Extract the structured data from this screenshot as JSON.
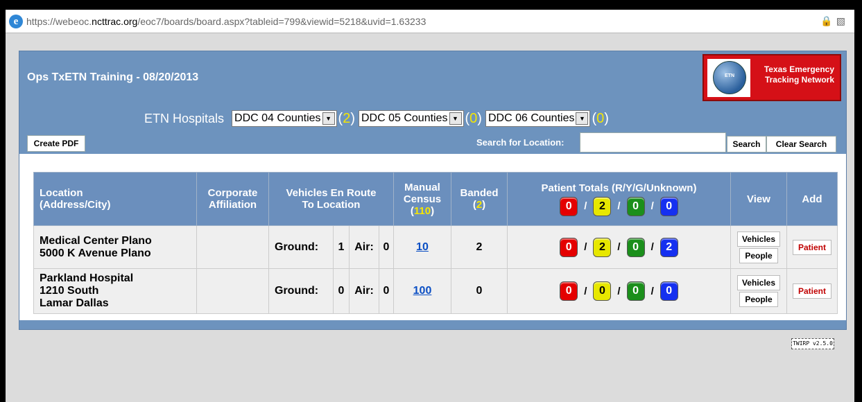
{
  "browser": {
    "url_prefix": "https://webeoc.",
    "url_domain": "ncttrac.org",
    "url_suffix": "/eoc7/boards/board.aspx?tableid=799&viewid=5218&uvid=1.63233"
  },
  "board": {
    "title": "Ops TxETN Training - 08/20/2013",
    "logo_line1": "Texas Emergency",
    "logo_line2": "Tracking Network",
    "logo_badge": "ETN",
    "hospitals_label": "ETN Hospitals",
    "filters": [
      {
        "label": "DDC 04 Counties",
        "count": "2"
      },
      {
        "label": "DDC 05 Counties",
        "count": "0"
      },
      {
        "label": "DDC 06 Counties",
        "count": "0"
      }
    ],
    "create_pdf": "Create PDF",
    "search_label": "Search for Location:",
    "search_value": "",
    "search_button": "Search",
    "clear_button": "Clear Search"
  },
  "table": {
    "headers": {
      "location": "Location",
      "location_sub": "(Address/City)",
      "corporate": "Corporate",
      "corporate_sub": "Affiliation",
      "vehicles": "Vehicles En Route",
      "vehicles_sub": "To Location",
      "manual": "Manual",
      "manual_sub": "Census",
      "manual_count": "110",
      "banded": "Banded",
      "banded_count": "2",
      "patient_totals": "Patient Totals (R/Y/G/Unknown)",
      "totals": {
        "red": "0",
        "yellow": "2",
        "green": "0",
        "blue": "0"
      },
      "view": "View",
      "add": "Add"
    },
    "ground_label": "Ground:",
    "air_label": "Air:",
    "rows": [
      {
        "line1": "Medical Center Plano",
        "line2": "5000 K Avenue Plano",
        "line3": "",
        "ground": "1",
        "air": "0",
        "census": "10",
        "banded": "2",
        "red": "0",
        "yellow": "2",
        "green": "0",
        "blue": "2",
        "view_vehicles": "Vehicles",
        "view_people": "People",
        "add_patient": "Patient"
      },
      {
        "line1": "Parkland Hospital",
        "line2": "1210 South",
        "line3": "Lamar Dallas",
        "ground": "0",
        "air": "0",
        "census": "100",
        "banded": "0",
        "red": "0",
        "yellow": "0",
        "green": "0",
        "blue": "0",
        "view_vehicles": "Vehicles",
        "view_people": "People",
        "add_patient": "Patient"
      }
    ]
  },
  "footer": {
    "version": "TWIRP v2.5.0"
  },
  "colors": {
    "panel": "#6d93be",
    "header": "#6b8fbd",
    "logo_red": "#d51017",
    "count_yellow": "#f6e600"
  },
  "icons": [
    "ie-icon",
    "lock-icon",
    "compat-icon",
    "dropdown-arrow-icon"
  ]
}
